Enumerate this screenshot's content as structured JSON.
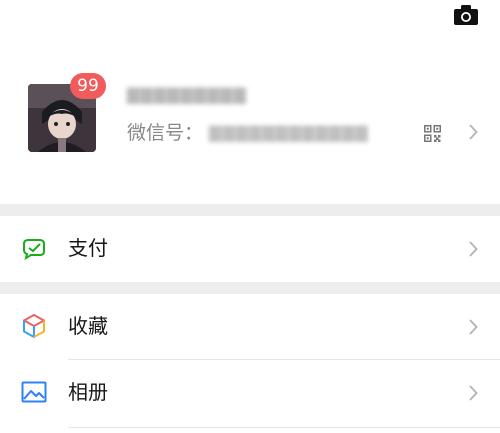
{
  "profile": {
    "badge_count": "99",
    "nickname": "▇▇▇▇▇▇▇▇▇",
    "wechat_id_label": "微信号：",
    "wechat_id_value": "▇▇▇▇▇▇▇▇▇▇▇▇"
  },
  "menu": {
    "pay_label": "支付",
    "favorites_label": "收藏",
    "album_label": "相册"
  },
  "colors": {
    "badge": "#f15b5b",
    "pay_green": "#1aad19",
    "divider": "#ededed"
  },
  "icons": {
    "camera": "camera-icon",
    "qr": "qr-code-icon",
    "chevron": "chevron-right-icon",
    "pay": "wallet-check-icon",
    "favorites": "cube-icon",
    "album": "image-icon"
  }
}
